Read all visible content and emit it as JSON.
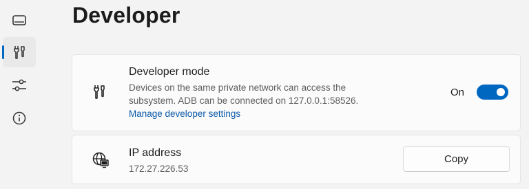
{
  "page": {
    "title": "Developer"
  },
  "nav": {
    "items": [
      {
        "icon": "display-icon",
        "active": false
      },
      {
        "icon": "tools-icon",
        "active": true
      },
      {
        "icon": "sliders-icon",
        "active": false
      },
      {
        "icon": "info-icon",
        "active": false
      }
    ]
  },
  "developer_mode": {
    "title": "Developer mode",
    "description": "Devices on the same private network can access the subsystem. ADB can be connected on 127.0.0.1:58526.",
    "link": "Manage developer settings",
    "toggle_label": "On",
    "toggle_on": true,
    "icon": "tools-icon"
  },
  "ip": {
    "title": "IP address",
    "value": "172.27.226.53",
    "button": "Copy",
    "icon": "globe-monitor-icon"
  },
  "colors": {
    "accent": "#0067c0",
    "link": "#0a5aa8"
  }
}
